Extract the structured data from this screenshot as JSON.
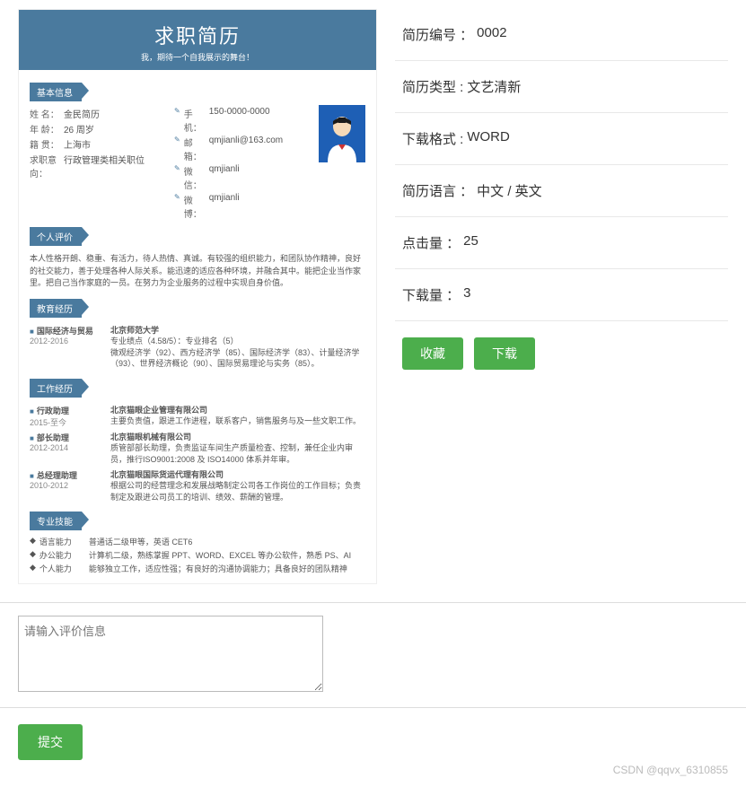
{
  "resume": {
    "title": "求职简历",
    "subtitle": "我，期待一个自我展示的舞台！",
    "sections": {
      "basic": "基本信息",
      "eval": "个人评价",
      "edu": "教育经历",
      "work": "工作经历",
      "skill": "专业技能"
    },
    "basic": {
      "name_lbl": "姓    名：",
      "name": "金民简历",
      "age_lbl": "年    龄：",
      "age": "26 周岁",
      "loc_lbl": "籍    贯：",
      "loc": "上海市",
      "goal_lbl": "求职意向：",
      "goal": "行政管理类相关职位",
      "phone_lbl": "手机：",
      "phone": "150-0000-0000",
      "email_lbl": "邮箱：",
      "email": "qmjianli@163.com",
      "wb_lbl": "微信：",
      "wb": "qmjianli",
      "wx_lbl": "微博：",
      "wx": "qmjianli"
    },
    "eval_text": "本人性格开朗、稳重、有活力，待人热情、真诚。有较强的组织能力，和团队协作精神，良好的社交能力，善于处理各种人际关系。能迅速的适应各种环境，并融合其中。能把企业当作家里。把自己当作家庭的一员。在努力为企业服务的过程中实现自身价值。",
    "edu": {
      "t1": "国际经济与贸易",
      "d1": "2012-2016",
      "school": "北京师范大学",
      "l1": "专业绩点（4.58/5）：专业排名（5）",
      "l2": "微观经济学（92）、西方经济学（85）、国际经济学（83）、计量经济学（93）、世界经济概论（90）、国际贸易理论与实务（85）。"
    },
    "work": [
      {
        "t": "行政助理",
        "d": "2015-至今",
        "co": "北京猫眼企业管理有限公司",
        "desc": "主要负责值，跟进工作进程，联系客户，销售服务与及一些文职工作。"
      },
      {
        "t": "部长助理",
        "d": "2012-2014",
        "co": "北京猫眼机械有限公司",
        "desc": "质管部部长助理，负责监证车间生产质量检查、控制，兼任企业内审员，推行ISO9001:2008 及 ISO14000 体系并年审。"
      },
      {
        "t": "总经理助理",
        "d": "2010-2012",
        "co": "北京猫眼国际货运代理有限公司",
        "desc": "根据公司的经营理念和发展战略制定公司各工作岗位的工作目标；负责制定及跟进公司员工的培训、绩效、薪酬的管理。"
      }
    ],
    "skills": [
      {
        "lbl": "语言能力",
        "v": "普通话二级甲等，英语 CET6"
      },
      {
        "lbl": "办公能力",
        "v": "计算机二级，熟练掌握 PPT、WORD、EXCEL 等办公软件，熟悉 PS、AI"
      },
      {
        "lbl": "个人能力",
        "v": "能够独立工作，适应性强；有良好的沟通协调能力；具备良好的团队精神"
      }
    ]
  },
  "info": {
    "id_lbl": "简历编号 ：",
    "id": "0002",
    "type_lbl": "简历类型 : ",
    "type": "文艺清新",
    "fmt_lbl": "下载格式 : ",
    "fmt": "WORD",
    "lang_lbl": "简历语言 ：",
    "lang": "中文 / 英文",
    "hits_lbl": "点击量 ：",
    "hits": "25",
    "dl_lbl": "下载量 ：",
    "dl": "3"
  },
  "buttons": {
    "fav": "收藏",
    "download": "下载",
    "submit": "提交"
  },
  "comment_placeholder": "请输入评价信息",
  "watermark": "CSDN @qqvx_6310855"
}
